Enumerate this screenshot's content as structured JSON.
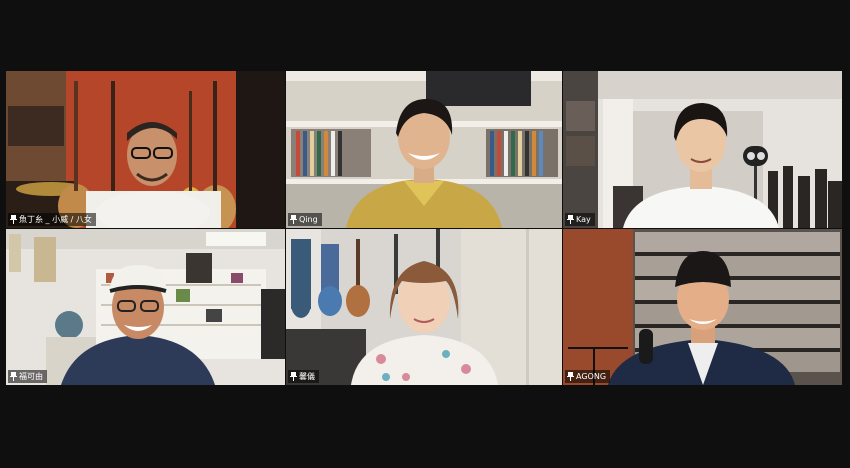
{
  "participants": [
    {
      "name": "魚丁糸 _ 小威 / 八女",
      "active": true
    },
    {
      "name": "Qing",
      "active": false
    },
    {
      "name": "Kay",
      "active": false
    },
    {
      "name": "福可由",
      "active": false
    },
    {
      "name": "馨儀",
      "active": false
    },
    {
      "name": "AGONG",
      "active": false
    }
  ],
  "colors": {
    "active_speaker_border": "#c9d03a",
    "background": "#0f0f0f"
  },
  "icons": {
    "name_tag_icon": "pin-icon"
  }
}
